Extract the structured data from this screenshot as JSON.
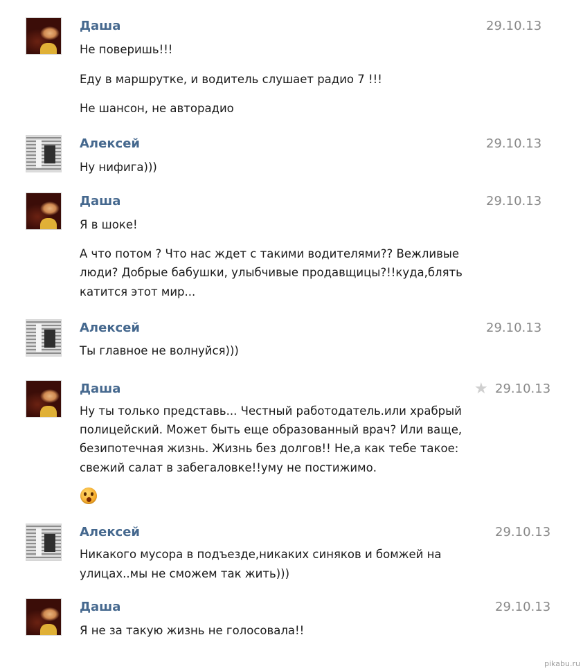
{
  "messages": [
    {
      "author": "Даша",
      "date": "29.10.13",
      "lines": [
        "Не поверишь!!!",
        "Еду в маршрутке, и водитель слушает радио 7 !!!",
        "Не шансон, не авторадио"
      ]
    },
    {
      "author": "Алексей",
      "date": "29.10.13",
      "lines": [
        "Ну нифига)))"
      ]
    },
    {
      "author": "Даша",
      "date": "29.10.13",
      "lines": [
        "Я в шоке!",
        "А что потом ? Что нас ждет с такими водителями?? Вежливые",
        "люди? Добрые бабушки, улыбчивые продавщицы?!!куда,блять",
        "катится этот мир..."
      ]
    },
    {
      "author": "Алексей",
      "date": "29.10.13",
      "lines": [
        "Ты главное не волнуйся)))"
      ]
    },
    {
      "author": "Даша",
      "date": "29.10.13",
      "lines": [
        "Ну ты только представь... Честный работодатель.или храбрый",
        "полицейский. Может быть еще образованный врач? Или ваще,",
        "безипотечная жизнь. Жизнь без долгов!! Не,а как тебе такое:",
        "свежий салат в забегаловке!!уму не постижимо."
      ]
    },
    {
      "author": "Алексей",
      "date": "29.10.13",
      "lines": [
        "Никакого мусора в подъезде,никаких синяков и бомжей на",
        "улицах..мы не сможем так жить)))"
      ]
    },
    {
      "author": "Даша",
      "date": "29.10.13",
      "lines": [
        "Я не за такую жизнь не голосовала!!"
      ]
    }
  ],
  "watermark": "pikabu.ru",
  "colors": {
    "author_name": "#45688e",
    "date": "#888888",
    "text": "#1a1a1a",
    "star": "#cfcfcf"
  },
  "icons": {
    "favorite": "star-icon",
    "emoji": "astonished-face-icon"
  }
}
